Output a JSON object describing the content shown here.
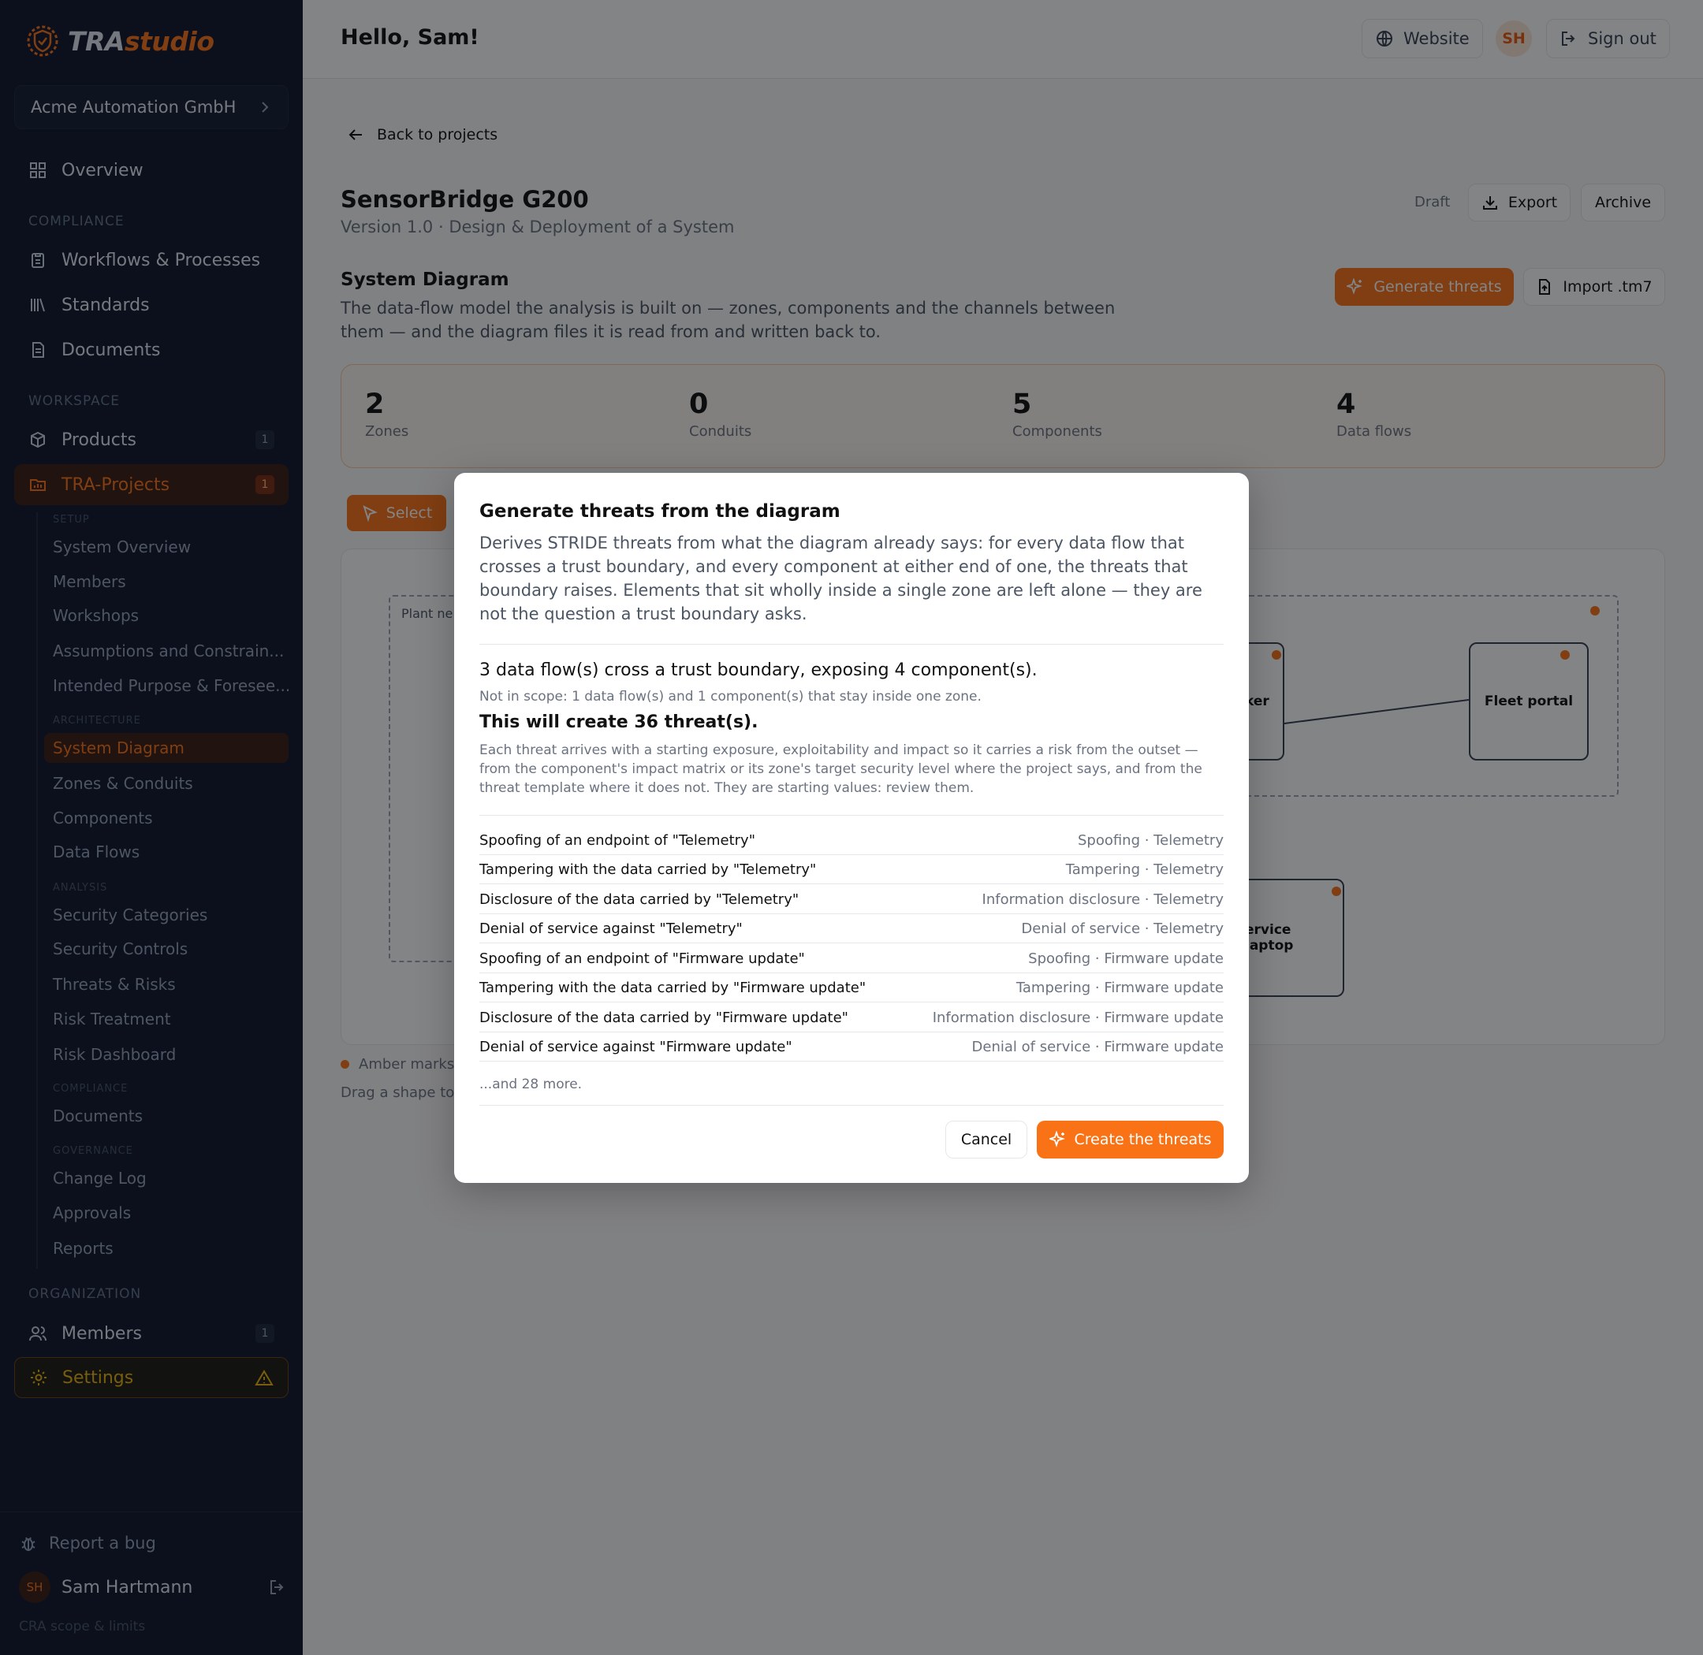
{
  "brand": {
    "part1": "TRA",
    "part2": "studio",
    "accent": "#f97316"
  },
  "org_switcher": {
    "label": "Acme Automation GmbH"
  },
  "nav": {
    "overview": "Overview",
    "compliance_label": "COMPLIANCE",
    "workflows": "Workflows & Processes",
    "standards": "Standards",
    "documents": "Documents",
    "workspace_label": "WORKSPACE",
    "products": {
      "label": "Products",
      "badge": "1"
    },
    "tra_projects": {
      "label": "TRA-Projects",
      "badge": "1"
    },
    "setup_label": "SETUP",
    "setup_items": [
      "System Overview",
      "Members",
      "Workshops",
      "Assumptions and Constrain...",
      "Intended Purpose & Foresee..."
    ],
    "architecture_label": "ARCHITECTURE",
    "architecture_items": [
      "System Diagram",
      "Zones & Conduits",
      "Components",
      "Data Flows"
    ],
    "analysis_label": "ANALYSIS",
    "analysis_items": [
      "Security Categories",
      "Security Controls",
      "Threats & Risks",
      "Risk Treatment",
      "Risk Dashboard"
    ],
    "sub_compliance_label": "COMPLIANCE",
    "sub_compliance_items": [
      "Documents"
    ],
    "governance_label": "GOVERNANCE",
    "governance_items": [
      "Change Log",
      "Approvals",
      "Reports"
    ],
    "organization_label": "ORGANIZATION",
    "members": {
      "label": "Members",
      "badge": "1"
    },
    "settings": "Settings"
  },
  "sidebar_footer": {
    "report_bug": "Report a bug",
    "user_initials": "SH",
    "user_name": "Sam Hartmann",
    "cra": "CRA scope & limits"
  },
  "topbar": {
    "greeting": "Hello, Sam!",
    "website": "Website",
    "avatar": "SH",
    "sign_out": "Sign out"
  },
  "project": {
    "back": "Back to projects",
    "title": "SensorBridge G200",
    "subtitle": "Version 1.0 · Design & Deployment of a System",
    "status": "Draft",
    "export": "Export",
    "archive": "Archive"
  },
  "diagram_section": {
    "title": "System Diagram",
    "description": "The data-flow model the analysis is built on — zones, components and the channels between them — and the diagram files it is read from and written back to.",
    "generate": "Generate threats",
    "import": "Import .tm7",
    "stats": [
      {
        "value": "2",
        "label": "Zones"
      },
      {
        "value": "0",
        "label": "Conduits"
      },
      {
        "value": "5",
        "label": "Components"
      },
      {
        "value": "4",
        "label": "Data flows"
      }
    ],
    "select_tool": "Select",
    "zone_label": "Plant ne",
    "nodes": {
      "broker": "ker",
      "fleet": "Fleet portal",
      "laptop": "ervice laptop"
    },
    "legend": "Amber marks",
    "drag_hint": "Drag a shape to"
  },
  "dialog": {
    "title": "Generate threats from the diagram",
    "description": "Derives STRIDE threats from what the diagram already says: for every data flow that crosses a trust boundary, and every component at either end of one, the threats that boundary raises. Elements that sit wholly inside a single zone are left alone — they are not the question a trust boundary asks.",
    "summary": "3 data flow(s) cross a trust boundary, exposing 4 component(s).",
    "not_in_scope": "Not in scope: 1 data flow(s) and 1 component(s) that stay inside one zone.",
    "will_create": "This will create 36 threat(s).",
    "note": "Each threat arrives with a starting exposure, exploitability and impact so it carries a risk from the outset — from the component's impact matrix or its zone's target security level where the project says, and from the threat template where it does not. They are starting values: review them.",
    "threats": [
      {
        "name": "Spoofing of an endpoint of \"Telemetry\"",
        "category": "Spoofing · Telemetry"
      },
      {
        "name": "Tampering with the data carried by \"Telemetry\"",
        "category": "Tampering · Telemetry"
      },
      {
        "name": "Disclosure of the data carried by \"Telemetry\"",
        "category": "Information disclosure · Telemetry"
      },
      {
        "name": "Denial of service against \"Telemetry\"",
        "category": "Denial of service · Telemetry"
      },
      {
        "name": "Spoofing of an endpoint of \"Firmware update\"",
        "category": "Spoofing · Firmware update"
      },
      {
        "name": "Tampering with the data carried by \"Firmware update\"",
        "category": "Tampering · Firmware update"
      },
      {
        "name": "Disclosure of the data carried by \"Firmware update\"",
        "category": "Information disclosure · Firmware update"
      },
      {
        "name": "Denial of service against \"Firmware update\"",
        "category": "Denial of service · Firmware update"
      }
    ],
    "more": "...and 28 more.",
    "cancel": "Cancel",
    "create": "Create the threats"
  }
}
